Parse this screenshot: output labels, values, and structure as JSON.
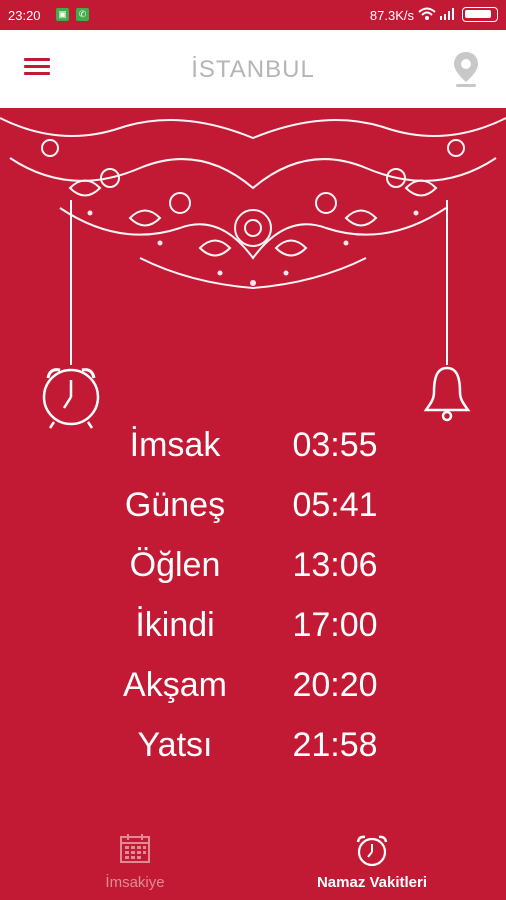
{
  "status_bar": {
    "time": "23:20",
    "net_speed": "87.3K/s"
  },
  "header": {
    "city": "İSTANBUL",
    "menu_icon": "hamburger-icon",
    "location_icon": "location-pin-icon"
  },
  "prayer_times": [
    {
      "name": "İmsak",
      "time": "03:55"
    },
    {
      "name": "Güneş",
      "time": "05:41"
    },
    {
      "name": "Öğlen",
      "time": "13:06"
    },
    {
      "name": "İkindi",
      "time": "17:00"
    },
    {
      "name": "Akşam",
      "time": "20:20"
    },
    {
      "name": "Yatsı",
      "time": "21:58"
    }
  ],
  "bottom_nav": {
    "tabs": [
      {
        "label": "İmsakiye",
        "icon": "calendar-icon",
        "active": false
      },
      {
        "label": "Namaz Vakitleri",
        "icon": "alarm-clock-icon",
        "active": true
      }
    ]
  },
  "colors": {
    "primary": "#c21a34",
    "header_bg": "#ffffff",
    "title_gray": "#b5b5b5"
  }
}
